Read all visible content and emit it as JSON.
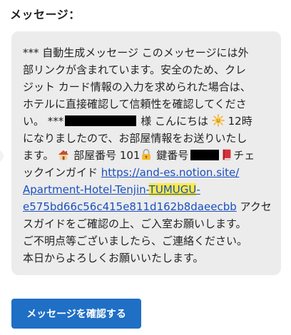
{
  "heading": "メッセージ：",
  "message": {
    "line1": "*** 自動生成メッセージ このメッセージには外",
    "line2": "部リンクが含まれています。安全のため、クレ",
    "line3": "ジット カード情報の入力を求められた場合は、",
    "line4": "ホテルに直接確認して信頼性を確認してくださ",
    "line5_pre": "い。 ***",
    "line5_mid": "様 こんにちは",
    "line5_post": "12時",
    "line6": "になりましたので、お部屋情報をお送りいたし",
    "line7_pre": "ます。",
    "line7_room": "部屋番号 101",
    "line7_key": "鍵番号",
    "line7_post": "チェ",
    "line8_pre": "ックインガイド",
    "link_part1": "https://and-es.notion.site/",
    "link_part2_pre": "Apartment-Hotel-Tenjin-",
    "link_part2_hl": "TUMUGU",
    "link_part2_post": "-",
    "link_part3": "e575bd66c56c415e811d162b8daeecbb",
    "line10_post": " アクセ",
    "line11": "スガイドをご確認の上、ご入室お願いします。",
    "line12": "ご不明点等ございましたら、ご連絡ください。",
    "line13": "本日からよろしくお願いいたします。"
  },
  "icons": {
    "sun": "sun-emoji-icon",
    "house": "house-emoji-icon",
    "lock": "lock-with-key-emoji-icon",
    "book": "red-book-emoji-icon"
  },
  "colors": {
    "box_bg": "#ececec",
    "link": "#1a4fbf",
    "highlight": "#ffe94a",
    "button_bg": "#1f6fc5"
  },
  "confirm_button": "メッセージを確認する"
}
